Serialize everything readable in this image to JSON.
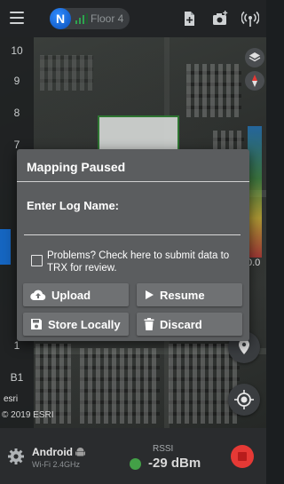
{
  "topbar": {
    "logo_letter": "N",
    "floor_label": "Floor 4"
  },
  "icons": {
    "menu": "menu-icon",
    "signal": "signal-bars-icon",
    "add_file": "add-file-icon",
    "add_photo": "add-photo-icon",
    "wireless": "wireless-icon",
    "layers": "layers-icon",
    "compass": "compass-icon",
    "locate_pin": "location-pin-icon",
    "gps": "gps-icon",
    "settings": "gear-icon",
    "android": "android-icon",
    "stop": "stop-icon"
  },
  "floors": [
    "10",
    "9",
    "8",
    "7",
    "1",
    "B1"
  ],
  "map": {
    "legend_value": "0.0",
    "attribution_logo": "esri",
    "attribution_copy": "© 2019 ESRI"
  },
  "dialog": {
    "title": "Mapping Paused",
    "log_name_label": "Enter Log Name:",
    "log_name_value": "",
    "problems_text": "Problems? Check here to submit data to TRX for review.",
    "problems_checked": false,
    "buttons": {
      "upload": "Upload",
      "resume": "Resume",
      "store_locally": "Store Locally",
      "discard": "Discard"
    }
  },
  "bottombar": {
    "device_name": "Android",
    "device_sub": "Wi-Fi 2.4GHz",
    "rssi_label": "RSSI",
    "rssi_value": "-29 dBm"
  },
  "colors": {
    "accent_blue": "#1565c0",
    "rssi_ok": "#43a047",
    "stop_red": "#e53935"
  }
}
